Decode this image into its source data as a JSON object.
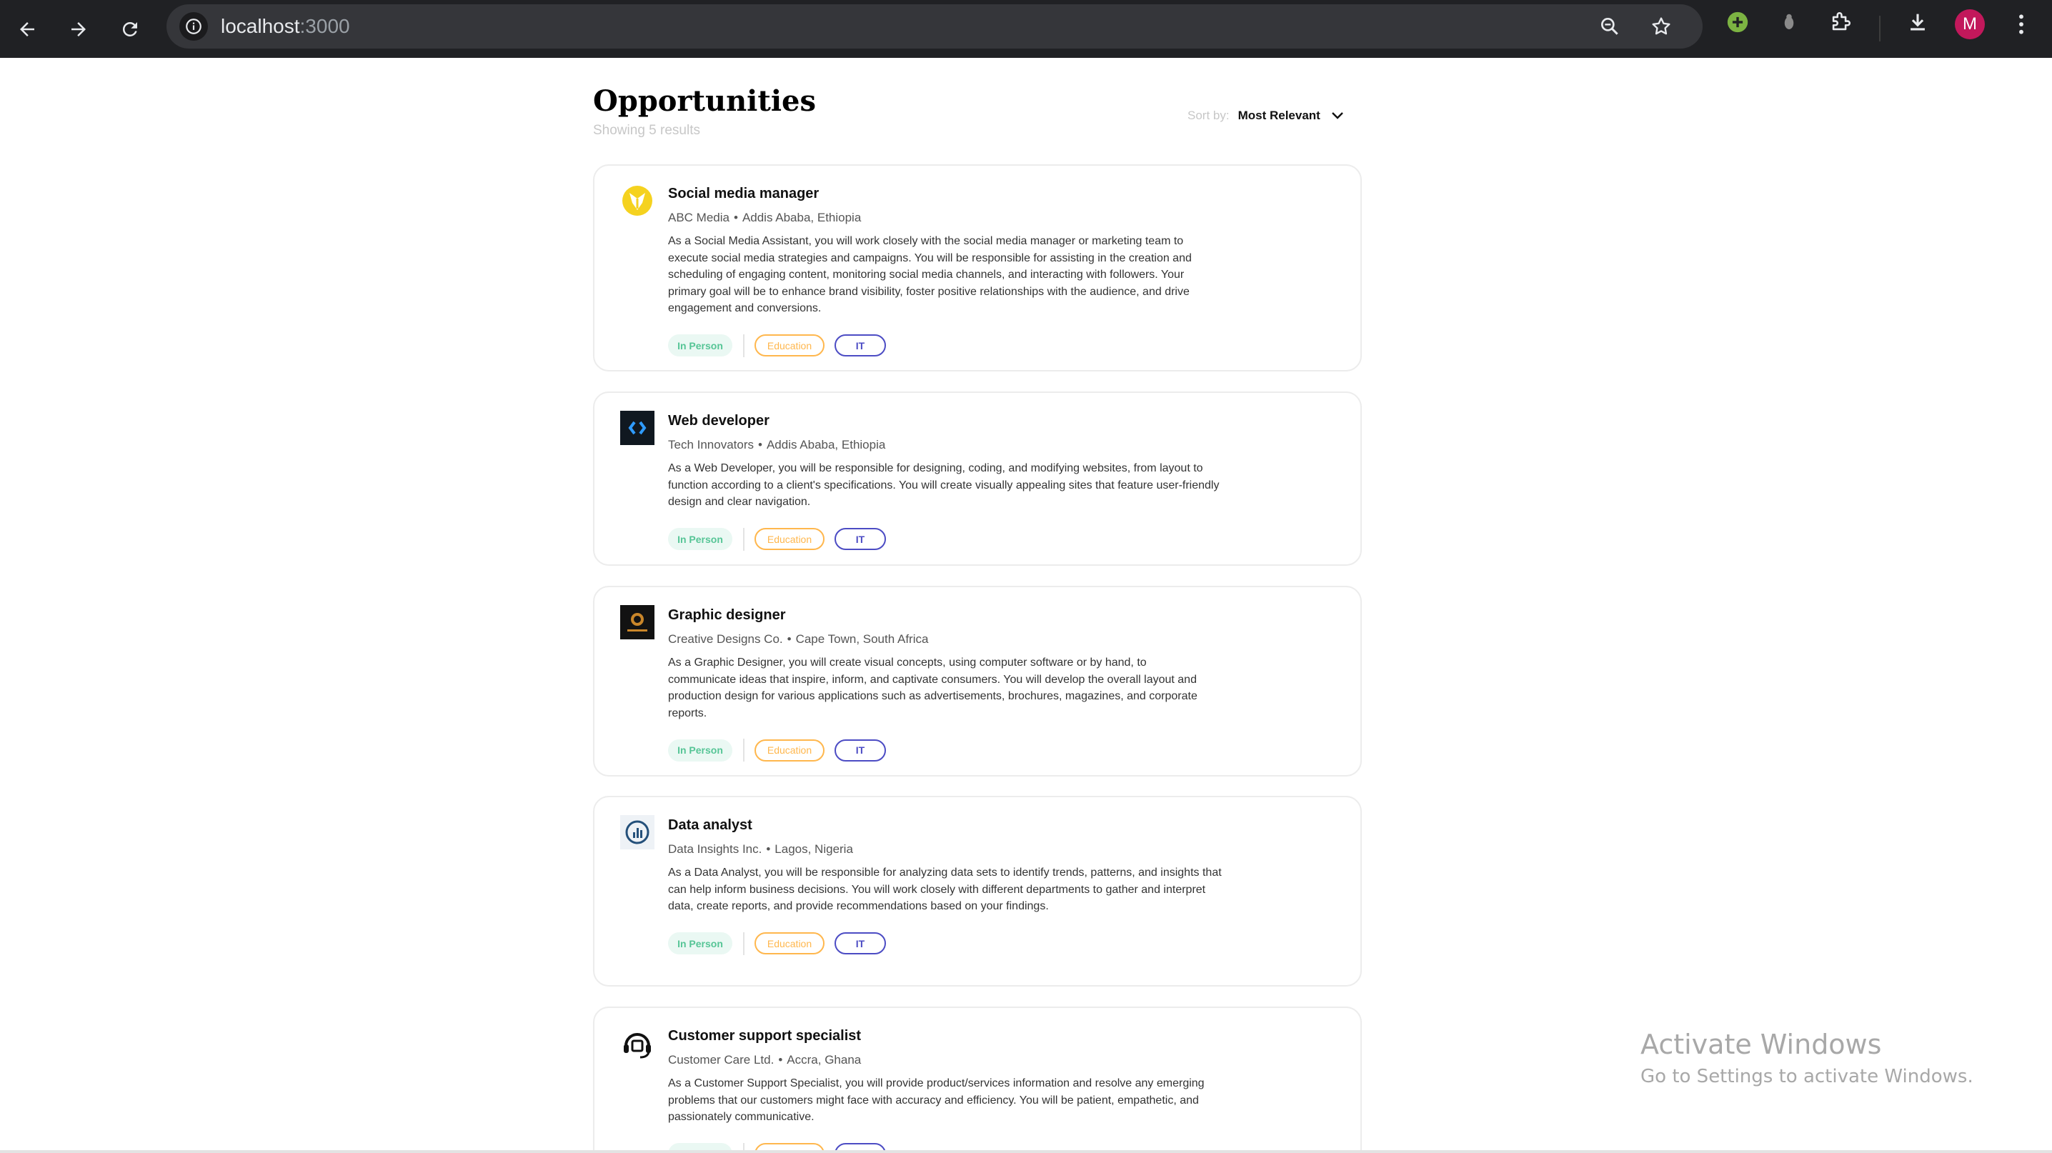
{
  "browser": {
    "url_host": "localhost",
    "url_port": ":3000",
    "avatar_letter": "M"
  },
  "header": {
    "title": "Opportunities",
    "results": "Showing 5 results",
    "sort_label": "Sort by:",
    "sort_value": "Most Relevant"
  },
  "jobs": [
    {
      "title": "Social media manager",
      "company": "ABC Media",
      "location": "Addis Ababa, Ethiopia",
      "description": "As a Social Media Assistant, you will work closely with the social media manager or marketing team to execute social media strategies and campaigns. You will be responsible for assisting in the creation and scheduling of engaging content, monitoring social media channels, and interacting with followers. Your primary goal will be to enhance brand visibility, foster positive relationships with the audience, and drive engagement and conversions.",
      "tags": [
        "In Person",
        "Education",
        "IT"
      ]
    },
    {
      "title": "Web developer",
      "company": "Tech Innovators",
      "location": "Addis Ababa, Ethiopia",
      "description": "As a Web Developer, you will be responsible for designing, coding, and modifying websites, from layout to function according to a client's specifications. You will create visually appealing sites that feature user-friendly design and clear navigation.",
      "tags": [
        "In Person",
        "Education",
        "IT"
      ]
    },
    {
      "title": "Graphic designer",
      "company": "Creative Designs Co.",
      "location": "Cape Town, South Africa",
      "description": "As a Graphic Designer, you will create visual concepts, using computer software or by hand, to communicate ideas that inspire, inform, and captivate consumers. You will develop the overall layout and production design for various applications such as advertisements, brochures, magazines, and corporate reports.",
      "tags": [
        "In Person",
        "Education",
        "IT"
      ]
    },
    {
      "title": "Data analyst",
      "company": "Data Insights Inc.",
      "location": "Lagos, Nigeria",
      "description": "As a Data Analyst, you will be responsible for analyzing data sets to identify trends, patterns, and insights that can help inform business decisions. You will work closely with different departments to gather and interpret data, create reports, and provide recommendations based on your findings.",
      "tags": [
        "In Person",
        "Education",
        "IT"
      ]
    },
    {
      "title": "Customer support specialist",
      "company": "Customer Care Ltd.",
      "location": "Accra, Ghana",
      "description": "As a Customer Support Specialist, you will provide product/services information and resolve any emerging problems that our customers might face with accuracy and efficiency. You will be patient, empathetic, and passionately communicative.",
      "tags": [
        "In Person",
        "Education",
        "IT"
      ]
    }
  ],
  "watermark": {
    "line1": "Activate Windows",
    "line2": "Go to Settings to activate Windows."
  }
}
